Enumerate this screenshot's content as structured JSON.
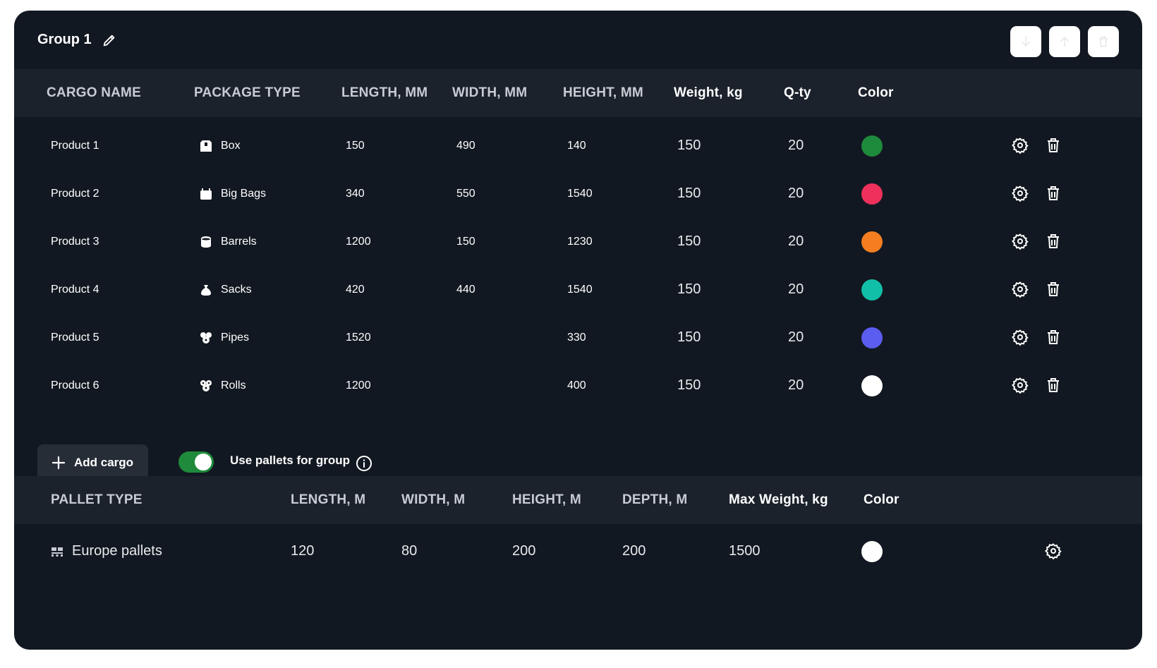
{
  "group": {
    "title": "Group 1"
  },
  "cargo_headers": [
    "CARGO NAME",
    "PACKAGE TYPE",
    "LENGTH, MM",
    "WIDTH, MM",
    "HEIGHT, MM",
    "Weight, kg",
    "Q-ty",
    "Color"
  ],
  "cargo_rows": [
    {
      "name": "Product 1",
      "package": "Box",
      "package_icon": "box-icon",
      "length": "150",
      "width": "490",
      "height": "140",
      "weight": "150",
      "qty": "20",
      "color": "#1e8a3c"
    },
    {
      "name": "Product 2",
      "package": "Big Bags",
      "package_icon": "big-bag-icon",
      "length": "340",
      "width": "550",
      "height": "1540",
      "weight": "150",
      "qty": "20",
      "color": "#f0305c"
    },
    {
      "name": "Product 3",
      "package": "Barrels",
      "package_icon": "barrel-icon",
      "length": "1200",
      "width": "150",
      "height": "1230",
      "weight": "150",
      "qty": "20",
      "color": "#f57e20"
    },
    {
      "name": "Product 4",
      "package": "Sacks",
      "package_icon": "sack-icon",
      "length": "420",
      "width": "440",
      "height": "1540",
      "weight": "150",
      "qty": "20",
      "color": "#10bfa8"
    },
    {
      "name": "Product 5",
      "package": "Pipes",
      "package_icon": "pipes-icon",
      "length": "1520",
      "width": "",
      "height": "330",
      "weight": "150",
      "qty": "20",
      "color": "#5b5cf0"
    },
    {
      "name": "Product 6",
      "package": "Rolls",
      "package_icon": "rolls-icon",
      "length": "1200",
      "width": "",
      "height": "400",
      "weight": "150",
      "qty": "20",
      "color": "#ffffff"
    }
  ],
  "controls": {
    "add_cargo_label": "Add cargo",
    "use_pallets_label": "Use pallets for group",
    "use_pallets_enabled": true
  },
  "pallet_headers": [
    "PALLET TYPE",
    "LENGTH, M",
    "WIDTH, M",
    "HEIGHT, M",
    "DEPTH, M",
    "Max Weight, kg",
    "Color"
  ],
  "pallet_rows": [
    {
      "type": "Europe pallets",
      "length": "120",
      "width": "80",
      "height": "200",
      "depth": "200",
      "max_weight": "1500",
      "color": "#ffffff"
    }
  ],
  "theme": {
    "background": "#121821",
    "header_band": "#1b222c",
    "toggle_on": "#1f8a3c"
  }
}
